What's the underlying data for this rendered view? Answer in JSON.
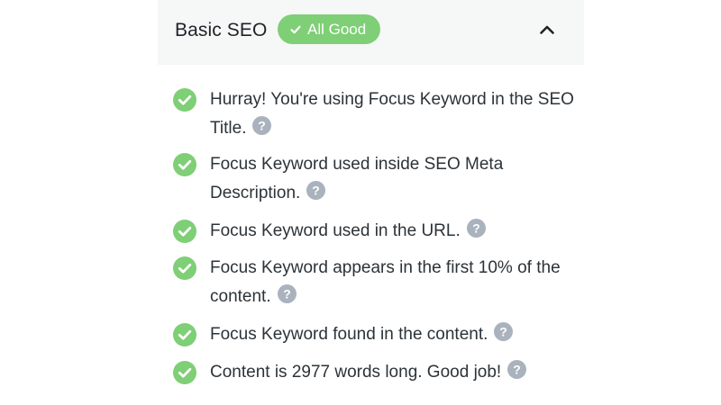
{
  "section": {
    "title": "Basic SEO",
    "badge_label": "All Good",
    "badge_icon": "check-icon",
    "toggle_icon": "chevron-up-icon",
    "expanded": true
  },
  "colors": {
    "success": "#7ecf75",
    "help": "#aab2bd",
    "header_bg": "#f6f7f7",
    "text": "#2c3338"
  },
  "checks": [
    {
      "text": "Hurray! You're using Focus Keyword in the SEO Title.",
      "status": "pass"
    },
    {
      "text": "Focus Keyword used inside SEO Meta Description.",
      "status": "pass"
    },
    {
      "text": "Focus Keyword used in the URL.",
      "status": "pass"
    },
    {
      "text": "Focus Keyword appears in the first 10% of the content.",
      "status": "pass"
    },
    {
      "text": "Focus Keyword found in the content.",
      "status": "pass"
    },
    {
      "text": "Content is 2977 words long. Good job!",
      "status": "pass"
    }
  ]
}
